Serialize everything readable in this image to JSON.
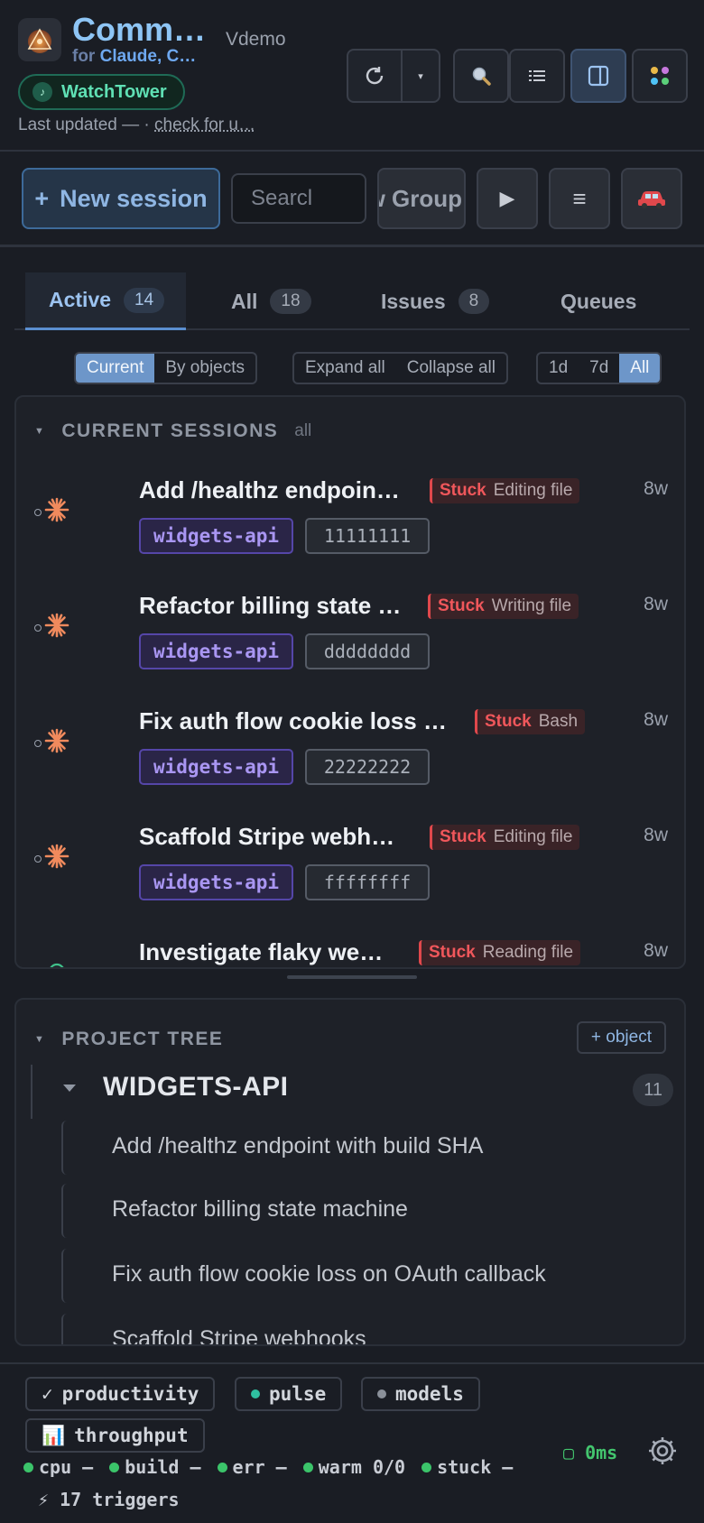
{
  "header": {
    "title": "Comm…",
    "subtitle_prefix": "for ",
    "subtitle_highlight": "Claude, C…",
    "workspace": "Vdemo",
    "watchtower_label": "WatchTower",
    "updated_prefix": "Last updated — ·",
    "update_link": "check for u…",
    "buttons": [
      "refresh",
      "dropdown",
      "search",
      "list",
      "panel",
      "apps"
    ]
  },
  "toolbar": {
    "new_session_label": "New session",
    "search_placeholder": "Searcl",
    "group_label": "w Group",
    "play_icon": "play",
    "menu_icon": "menu",
    "car_icon": "car"
  },
  "tabs": [
    {
      "label": "Active",
      "count": "14"
    },
    {
      "label": "All",
      "count": "18"
    },
    {
      "label": "Issues",
      "count": "8"
    },
    {
      "label": "Queues",
      "count": ""
    }
  ],
  "filters": {
    "view": [
      "Current",
      "By objects"
    ],
    "view_selected": "Current",
    "expand": [
      "Expand all",
      "Collapse all"
    ],
    "range": [
      "1d",
      "7d",
      "All"
    ],
    "range_selected": "All"
  },
  "sessions_panel": {
    "heading": "CURRENT SESSIONS",
    "scope": "all",
    "sessions": [
      {
        "title": "Add /healthz endpoin…",
        "status": "Stuck",
        "activity": "Editing file",
        "age": "8w",
        "project": "widgets-api",
        "id": "11111111"
      },
      {
        "title": "Refactor billing state …",
        "status": "Stuck",
        "activity": "Writing file",
        "age": "8w",
        "project": "widgets-api",
        "id": "dddddddd"
      },
      {
        "title": "Fix auth flow cookie loss …",
        "status": "Stuck",
        "activity": "Bash",
        "age": "8w",
        "project": "widgets-api",
        "id": "22222222"
      },
      {
        "title": "Scaffold Stripe webh…",
        "status": "Stuck",
        "activity": "Editing file",
        "age": "8w",
        "project": "widgets-api",
        "id": "ffffffff"
      },
      {
        "title": "Investigate flaky we…",
        "status": "Stuck",
        "activity": "Reading file",
        "age": "8w",
        "project": "",
        "id": ""
      }
    ]
  },
  "project_tree": {
    "heading": "PROJECT TREE",
    "add_label": "+ object",
    "node": {
      "name": "WIDGETS-API",
      "count": "11"
    },
    "items": [
      "Add /healthz endpoint with build SHA",
      "Refactor billing state machine",
      "Fix auth flow cookie loss on OAuth callback",
      "Scaffold Stripe webhooks"
    ]
  },
  "footer": {
    "chips": [
      {
        "icon": "✓",
        "label": "productivity"
      },
      {
        "icon": "●",
        "label": "pulse",
        "color": "#2fbfa0"
      },
      {
        "icon": "●",
        "label": "models",
        "color": "#8a9099"
      },
      {
        "icon": "📊",
        "label": "throughput"
      }
    ],
    "latency": "▢ 0ms",
    "stats": [
      "cpu —",
      "build —",
      "err —",
      "warm 0/0",
      "stuck —"
    ],
    "triggers": "⚡ 17 triggers"
  },
  "colors": {
    "accent": "#8ec5f5",
    "stuck": "#f0575b",
    "project_tag": "#a996f2",
    "ok": "#3bc46a"
  }
}
